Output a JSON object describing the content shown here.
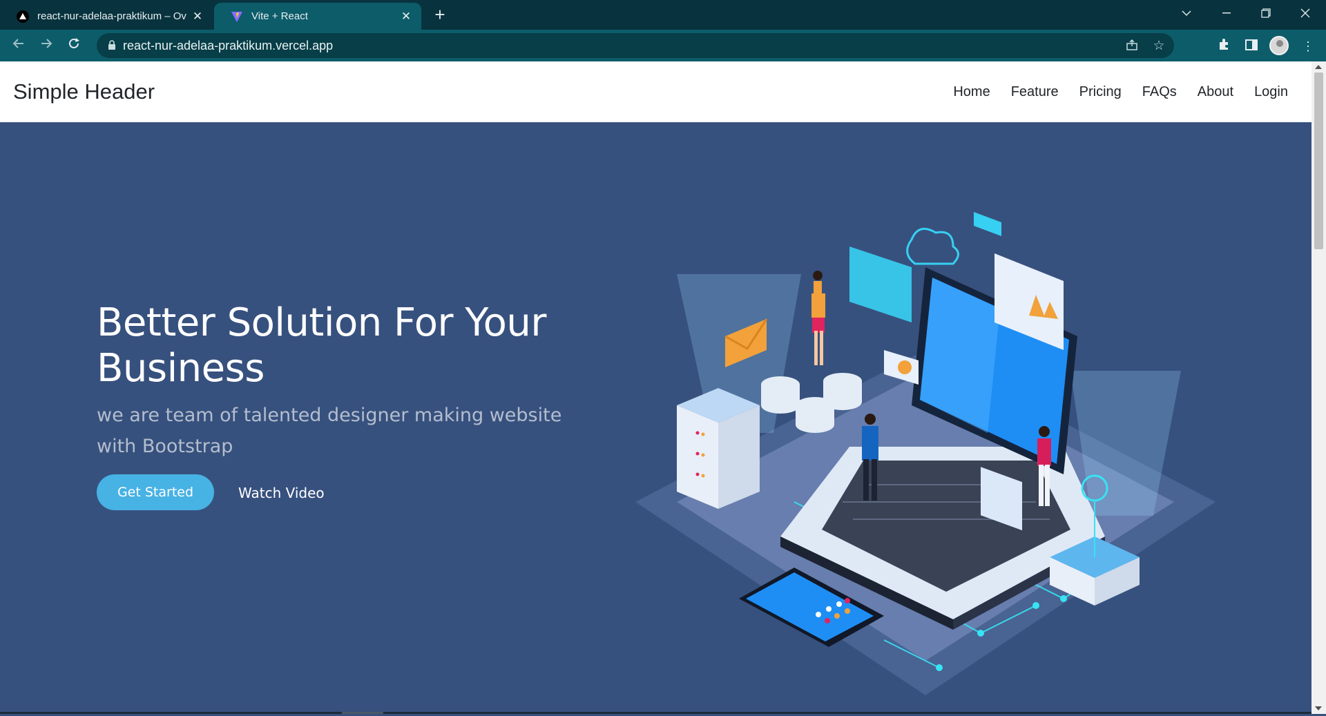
{
  "browser": {
    "tabs": [
      {
        "title": "react-nur-adelaa-praktikum – Ov",
        "active": false,
        "favicon": "vercel-triangle-icon"
      },
      {
        "title": "Vite + React",
        "active": true,
        "favicon": "vite-icon"
      }
    ],
    "url": "react-nur-adelaa-praktikum.vercel.app"
  },
  "header": {
    "brand": "Simple Header",
    "nav": [
      "Home",
      "Feature",
      "Pricing",
      "FAQs",
      "About",
      "Login"
    ]
  },
  "hero": {
    "title": "Better Solution For Your Business",
    "subtitle": "we are team of talented designer making website with Bootstrap",
    "cta_primary": "Get Started",
    "cta_secondary": "Watch Video"
  },
  "colors": {
    "hero_bg": "#37517e",
    "accent": "#47b2e4",
    "chrome": "#0d5c6a"
  }
}
